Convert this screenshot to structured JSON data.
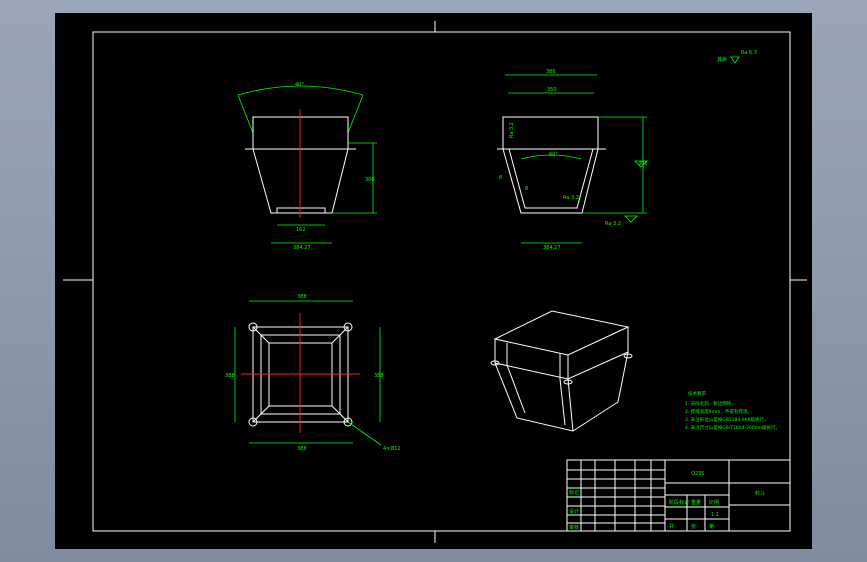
{
  "colors": {
    "sheet": "#000000",
    "border": "#ffffff",
    "dimension": "#00ff00",
    "centerline": "#ff2020"
  },
  "front_view": {
    "angle": "40°",
    "height": "300",
    "bottom_width": "162",
    "total_width": "384.27"
  },
  "side_view": {
    "top_width": "386",
    "inner_width": "350",
    "angle": "60°",
    "height": "300",
    "bottom_width": "384.27",
    "rough1": "Ra 3.2",
    "rough2": "Ra 3.2",
    "rough3": "Ra 3.2",
    "weld1": "8",
    "weld2": "8"
  },
  "plan_view": {
    "top_dim": "388",
    "left_dim": "388",
    "right_dim": "388",
    "bottom_dim": "388",
    "holes": "4×Ø12"
  },
  "roughness_note": {
    "prefix": "其余",
    "value": "Ra 6.3"
  },
  "tech_req": {
    "title": "技术要求",
    "lines": [
      "1. 去除毛刺、锐边倒钝。",
      "2. 焊缝高度8mm，不得有焊渣。",
      "3. 未注形位公差按GB1184-96K级执行。",
      "4. 未注尺寸公差按GB/T1804-2000m级执行。"
    ]
  },
  "title_block": {
    "material": "Q235",
    "part_name": "料斗",
    "scale": "1:1",
    "cells_row1": "标记",
    "cells_row2": "设计",
    "cells_row3": "审核",
    "stage": "阶段标记",
    "weight": "重量",
    "ratio": "比例",
    "sheet_label": "共",
    "sheet_of": "张",
    "sheet_no": "第"
  }
}
